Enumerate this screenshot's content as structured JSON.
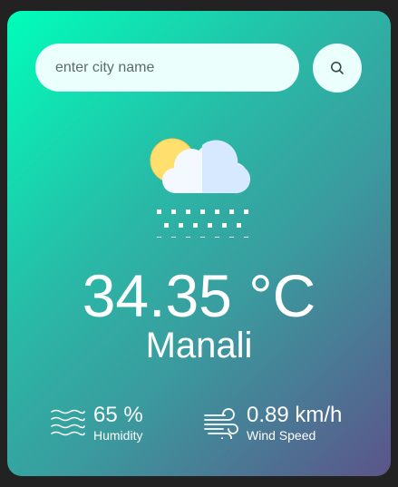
{
  "search": {
    "placeholder": "enter city name",
    "button_icon": "search-icon"
  },
  "weather": {
    "icon": "snow-cloud-sun-icon",
    "temperature": "34.35 °C",
    "city": "Manali"
  },
  "details": {
    "humidity": {
      "icon": "humidity-waves-icon",
      "value": "65 %",
      "label": "Humidity"
    },
    "wind": {
      "icon": "wind-icon",
      "value": "0.89 km/h",
      "label": "Wind Speed"
    }
  },
  "colors": {
    "gradient_start": "#00feba",
    "gradient_end": "#5b548a",
    "input_bg": "#ebfffc",
    "text": "#ffffff"
  }
}
